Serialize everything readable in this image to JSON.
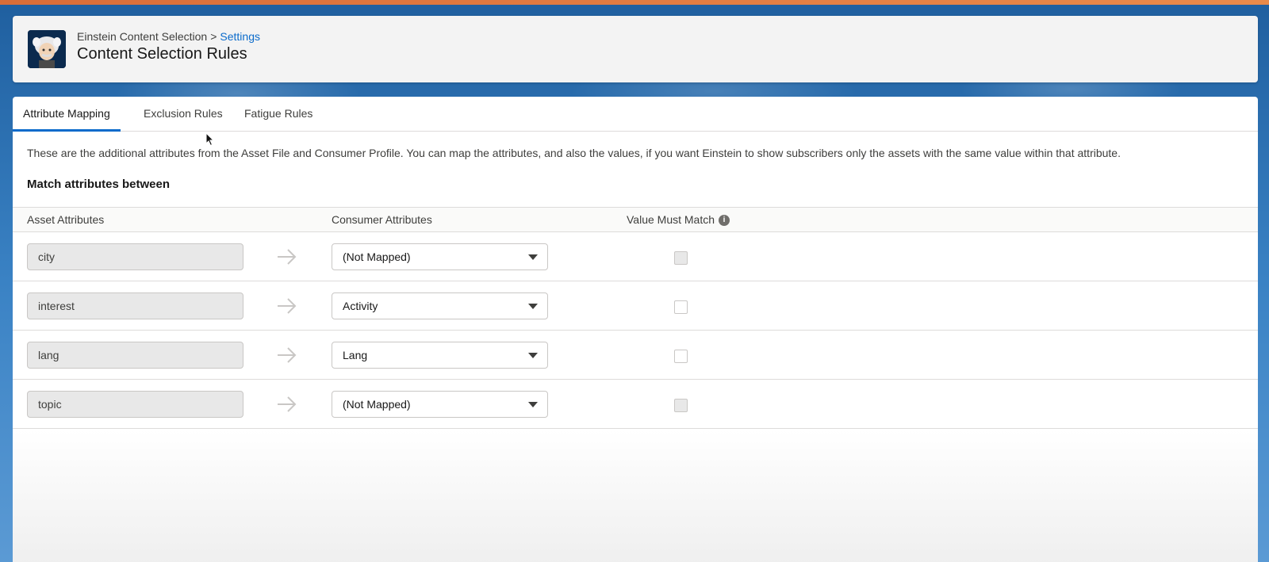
{
  "header": {
    "breadcrumb_app": "Einstein Content Selection",
    "breadcrumb_separator": ">",
    "breadcrumb_link": "Settings",
    "title": "Content Selection Rules",
    "icon": "einstein-avatar-icon"
  },
  "tabs": [
    {
      "label": "Attribute Mapping",
      "active": true
    },
    {
      "label": "Exclusion Rules",
      "active": false
    },
    {
      "label": "Fatigue Rules",
      "active": false
    }
  ],
  "main": {
    "description": "These are the additional attributes from the Asset File and Consumer Profile. You can map the attributes, and also the values, if you want Einstein to show subscribers only the assets with the same value within that attribute.",
    "subheading": "Match attributes between"
  },
  "table": {
    "columns": {
      "asset": "Asset Attributes",
      "consumer": "Consumer Attributes",
      "match": "Value Must Match"
    },
    "info_icon": "i",
    "rows": [
      {
        "asset": "city",
        "consumer": "(Not Mapped)",
        "match_checked": false,
        "match_disabled": true
      },
      {
        "asset": "interest",
        "consumer": "Activity",
        "match_checked": false,
        "match_disabled": false
      },
      {
        "asset": "lang",
        "consumer": "Lang",
        "match_checked": false,
        "match_disabled": false
      },
      {
        "asset": "topic",
        "consumer": "(Not Mapped)",
        "match_checked": false,
        "match_disabled": true
      }
    ]
  },
  "colors": {
    "accent": "#0b6bcb",
    "top_stripe": "#d96d38",
    "background": "#2a6fb0"
  }
}
